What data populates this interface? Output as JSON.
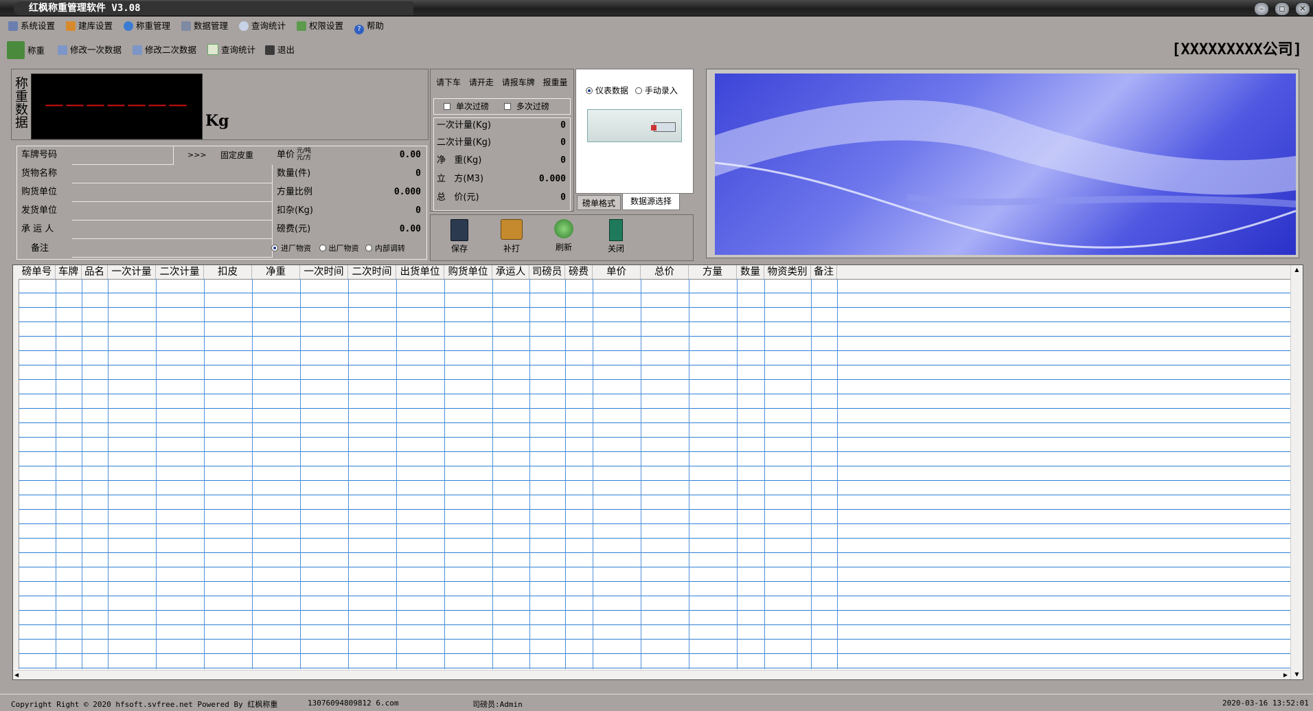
{
  "window": {
    "title": "红枫称重管理软件 V3.08"
  },
  "menu": {
    "items": [
      "系统设置",
      "建库设置",
      "称重管理",
      "数据管理",
      "查询统计",
      "权限设置",
      "帮助"
    ]
  },
  "toolbar": {
    "items": [
      "称重",
      "修改一次数据",
      "修改二次数据",
      "查询统计",
      "退出"
    ]
  },
  "company": "[XXXXXXXXX公司]",
  "scale": {
    "side_label": "称重数据",
    "reading": "———————",
    "unit": "Kg"
  },
  "form": {
    "plate_label": "车牌号码",
    "arrow_button": ">>>",
    "fixed_tare_button": "固定皮重",
    "unit_price_label": "单价",
    "unit_price_suffix_top": "元/吨",
    "unit_price_suffix_bottom": "元/方",
    "unit_price_value": "0.00",
    "goods_label": "货物名称",
    "quantity_label": "数量(件)",
    "quantity_value": "0",
    "buyer_label": "购货单位",
    "volume_ratio_label": "方量比例",
    "volume_ratio_value": "0.000",
    "shipper_label": "发货单位",
    "deduction_label": "扣杂(Kg)",
    "deduction_value": "0",
    "carrier_label": "承 运 人",
    "fee_label": "磅费(元)",
    "fee_value": "0.00",
    "remark_label": "备注",
    "direction_options": [
      "进厂物资",
      "出厂物资",
      "内部调转"
    ],
    "direction_selected": "进厂物资"
  },
  "voice": {
    "buttons": [
      "请下车",
      "请开走",
      "请报车牌",
      "报重量"
    ]
  },
  "weigh_mode": {
    "options": [
      "单次过磅",
      "多次过磅"
    ]
  },
  "summary": {
    "first_label": "一次计量(Kg)",
    "first_value": "0",
    "second_label": "二次计量(Kg)",
    "second_value": "0",
    "net_label": "净   重(Kg)",
    "net_value": "0",
    "volume_label": "立   方(M3)",
    "volume_value": "0.000",
    "total_label": "总   价(元)",
    "total_value": "0"
  },
  "actions": {
    "buttons": [
      "保存",
      "补打",
      "刷新",
      "关闭"
    ]
  },
  "datasource": {
    "options": [
      "仪表数据",
      "手动录入"
    ],
    "selected": "仪表数据",
    "tabs": [
      "磅单格式",
      "数据源选择"
    ],
    "active_tab": "数据源选择"
  },
  "grid": {
    "columns": [
      "磅单号",
      "车牌",
      "品名",
      "一次计量",
      "二次计量",
      "扣皮",
      "净重",
      "一次时间",
      "二次时间",
      "出货单位",
      "购货单位",
      "承运人",
      "司磅员",
      "磅费",
      "单价",
      "总价",
      "方量",
      "数量",
      "物资类别",
      "备注"
    ],
    "rows": []
  },
  "status": {
    "copyright": "Copyright Right © 2020 hfsoft.svfree.net Powered By 红枫称重",
    "contact": "13076094809812 6.com",
    "operator": "司磅员:Admin",
    "datetime": "2020-03-16 13:52:01"
  },
  "colors": {
    "background": "#a8a3a0",
    "led_bg": "#000000",
    "led_digits": "#d01010",
    "grid_lines": "#2f7fd6",
    "banner": "#5a63e6"
  }
}
